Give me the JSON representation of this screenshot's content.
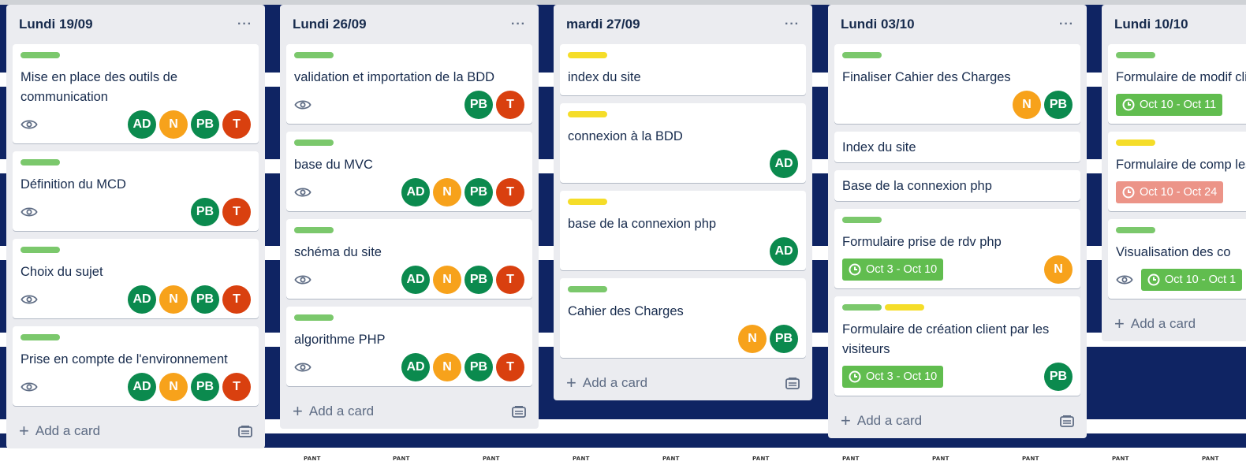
{
  "colors": {
    "label_green": "#7bc86c",
    "label_yellow": "#f5dd29",
    "AD": "#0b8a4e",
    "N": "#f7a21b",
    "PB": "#0b8a4e",
    "T": "#d9400f",
    "date_green": "#61bd4f",
    "date_red": "#ec9488"
  },
  "lists": [
    {
      "title": "Lundi 19/09",
      "menu": "···",
      "add_card": "Add a card",
      "cards": [
        {
          "labels": [
            "green"
          ],
          "title": "Mise en place des outils de communication",
          "watch": true,
          "members": [
            "AD",
            "N",
            "PB",
            "T"
          ]
        },
        {
          "labels": [
            "green"
          ],
          "title": "Définition du MCD",
          "watch": true,
          "members": [
            "PB",
            "T"
          ]
        },
        {
          "labels": [
            "green"
          ],
          "title": "Choix du sujet",
          "watch": true,
          "members": [
            "AD",
            "N",
            "PB",
            "T"
          ]
        },
        {
          "labels": [
            "green"
          ],
          "title": "Prise en compte de l'environnement",
          "watch": true,
          "members": [
            "AD",
            "N",
            "PB",
            "T"
          ]
        }
      ]
    },
    {
      "title": "Lundi 26/09",
      "menu": "···",
      "add_card": "Add a card",
      "cards": [
        {
          "labels": [
            "green"
          ],
          "title": "validation et importation de la BDD",
          "watch": true,
          "members": [
            "PB",
            "T"
          ]
        },
        {
          "labels": [
            "green"
          ],
          "title": "base du MVC",
          "watch": true,
          "members": [
            "AD",
            "N",
            "PB",
            "T"
          ]
        },
        {
          "labels": [
            "green"
          ],
          "title": "schéma du site",
          "watch": true,
          "members": [
            "AD",
            "N",
            "PB",
            "T"
          ]
        },
        {
          "labels": [
            "green"
          ],
          "title": "algorithme PHP",
          "watch": true,
          "members": [
            "AD",
            "N",
            "PB",
            "T"
          ]
        }
      ]
    },
    {
      "title": "mardi 27/09",
      "menu": "···",
      "add_card": "Add a card",
      "cards": [
        {
          "labels": [
            "yellow"
          ],
          "title": "index du site",
          "members": []
        },
        {
          "labels": [
            "yellow"
          ],
          "title": "connexion à la BDD",
          "members": [
            "AD"
          ]
        },
        {
          "labels": [
            "yellow"
          ],
          "title": "base de la connexion php",
          "members": [
            "AD"
          ]
        },
        {
          "labels": [
            "green"
          ],
          "title": "Cahier des Charges",
          "members": [
            "N",
            "PB"
          ]
        }
      ]
    },
    {
      "title": "Lundi 03/10",
      "menu": "···",
      "add_card": "Add a card",
      "cards": [
        {
          "labels": [
            "green"
          ],
          "title": "Finaliser Cahier des Charges",
          "members": [
            "N",
            "PB"
          ]
        },
        {
          "labels": [],
          "title": "Index du site",
          "members": []
        },
        {
          "labels": [],
          "title": "Base de la connexion php",
          "members": []
        },
        {
          "labels": [
            "green"
          ],
          "title": "Formulaire prise de rdv php",
          "date": "Oct 3 - Oct 10",
          "date_color": "green",
          "members": [
            "N"
          ]
        },
        {
          "labels": [
            "green",
            "yellow"
          ],
          "title": "Formulaire de création client par les visiteurs",
          "date": "Oct 3 - Oct 10",
          "date_color": "green",
          "members": [
            "PB"
          ]
        }
      ]
    },
    {
      "title": "Lundi 10/10",
      "menu": "",
      "add_card": "Add a card",
      "cards": [
        {
          "labels": [
            "green"
          ],
          "title": "Formulaire de modif client",
          "date": "Oct 10 - Oct 11",
          "date_color": "green",
          "members": []
        },
        {
          "labels": [
            "yellow"
          ],
          "title": "Formulaire de comp les visiteurs",
          "date": "Oct 10 - Oct 24",
          "date_color": "red",
          "members": []
        },
        {
          "labels": [
            "green"
          ],
          "title": "Visualisation des co",
          "watch": true,
          "date": "Oct 10 - Oct 1",
          "date_color": "green",
          "members": []
        }
      ]
    }
  ],
  "background_text": "PANT"
}
